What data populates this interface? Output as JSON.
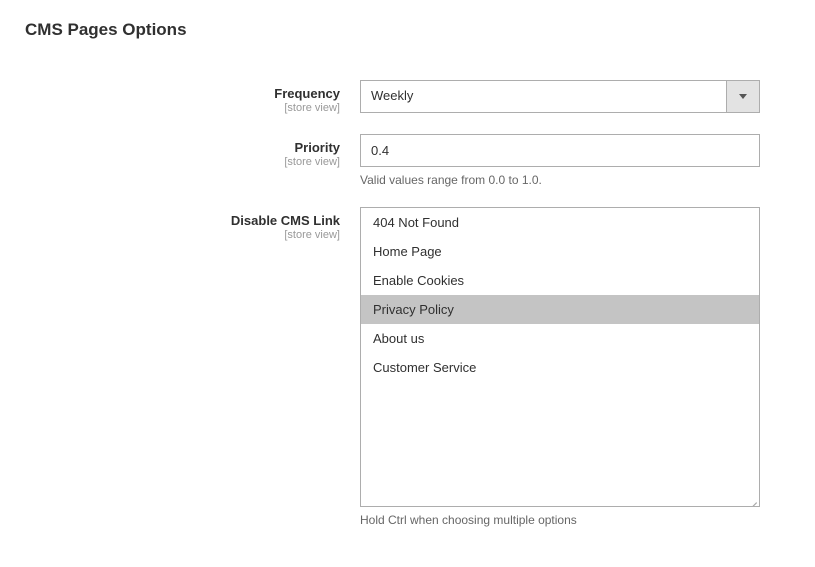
{
  "section": {
    "title": "CMS Pages Options"
  },
  "fields": {
    "frequency": {
      "label": "Frequency",
      "scope": "[store view]",
      "value": "Weekly"
    },
    "priority": {
      "label": "Priority",
      "scope": "[store view]",
      "value": "0.4",
      "help": "Valid values range from 0.0 to 1.0."
    },
    "disable_cms_link": {
      "label": "Disable CMS Link",
      "scope": "[store view]",
      "options": [
        {
          "label": "404 Not Found",
          "selected": false
        },
        {
          "label": "Home Page",
          "selected": false
        },
        {
          "label": "Enable Cookies",
          "selected": false
        },
        {
          "label": "Privacy Policy",
          "selected": true
        },
        {
          "label": "About us",
          "selected": false
        },
        {
          "label": "Customer Service",
          "selected": false
        }
      ],
      "help": "Hold Ctrl when choosing multiple options"
    }
  }
}
